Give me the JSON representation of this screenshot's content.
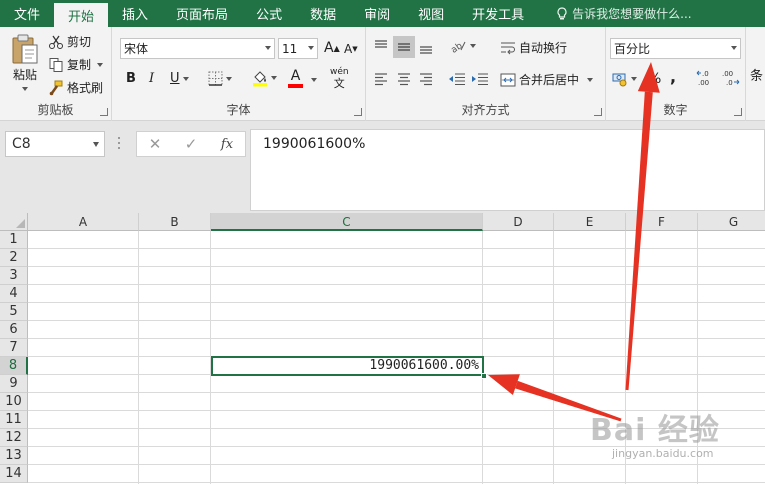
{
  "tabs": [
    {
      "label": "文件",
      "active": false
    },
    {
      "label": "开始",
      "active": true
    },
    {
      "label": "插入",
      "active": false
    },
    {
      "label": "页面布局",
      "active": false
    },
    {
      "label": "公式",
      "active": false
    },
    {
      "label": "数据",
      "active": false
    },
    {
      "label": "审阅",
      "active": false
    },
    {
      "label": "视图",
      "active": false
    },
    {
      "label": "开发工具",
      "active": false
    }
  ],
  "tell_me": "告诉我您想要做什么...",
  "clipboard": {
    "paste": "粘贴",
    "cut": "剪切",
    "copy": "复制",
    "format_painter": "格式刷",
    "group_label": "剪贴板"
  },
  "font": {
    "name": "宋体",
    "size": "11",
    "grow": "A",
    "shrink": "A",
    "bold": "B",
    "italic": "I",
    "underline": "U",
    "font_color_glyph": "A",
    "phonetic_top": "wén",
    "phonetic_bottom": "文",
    "group_label": "字体"
  },
  "alignment": {
    "wrap_text": "自动换行",
    "merge_center": "合并后居中",
    "group_label": "对齐方式"
  },
  "number": {
    "format": "百分比",
    "percent": "%",
    "comma": ",",
    "increase_decimal": "←.0\n.00",
    "decrease_decimal": ".00\n→.0",
    "group_label": "数字"
  },
  "styles": {
    "conditional": "条"
  },
  "name_box": "C8",
  "formula_buttons": {
    "cancel": "✕",
    "enter": "✓",
    "fx": "fx"
  },
  "formula_value": "1990061600%",
  "columns": [
    "A",
    "B",
    "C",
    "D",
    "E",
    "F",
    "G"
  ],
  "selected_column": "C",
  "rows": [
    "1",
    "2",
    "3",
    "4",
    "5",
    "6",
    "7",
    "8",
    "9",
    "10",
    "11",
    "12",
    "13",
    "14"
  ],
  "selected_row": "8",
  "active_cell_value": "1990061600.00%",
  "watermark": {
    "brand": "Bai 经验",
    "url": "jingyan.baidu.com"
  },
  "colors": {
    "excel_green": "#217346",
    "arrow_red": "#e53222",
    "ribbon_bg": "#f3f3f3"
  }
}
